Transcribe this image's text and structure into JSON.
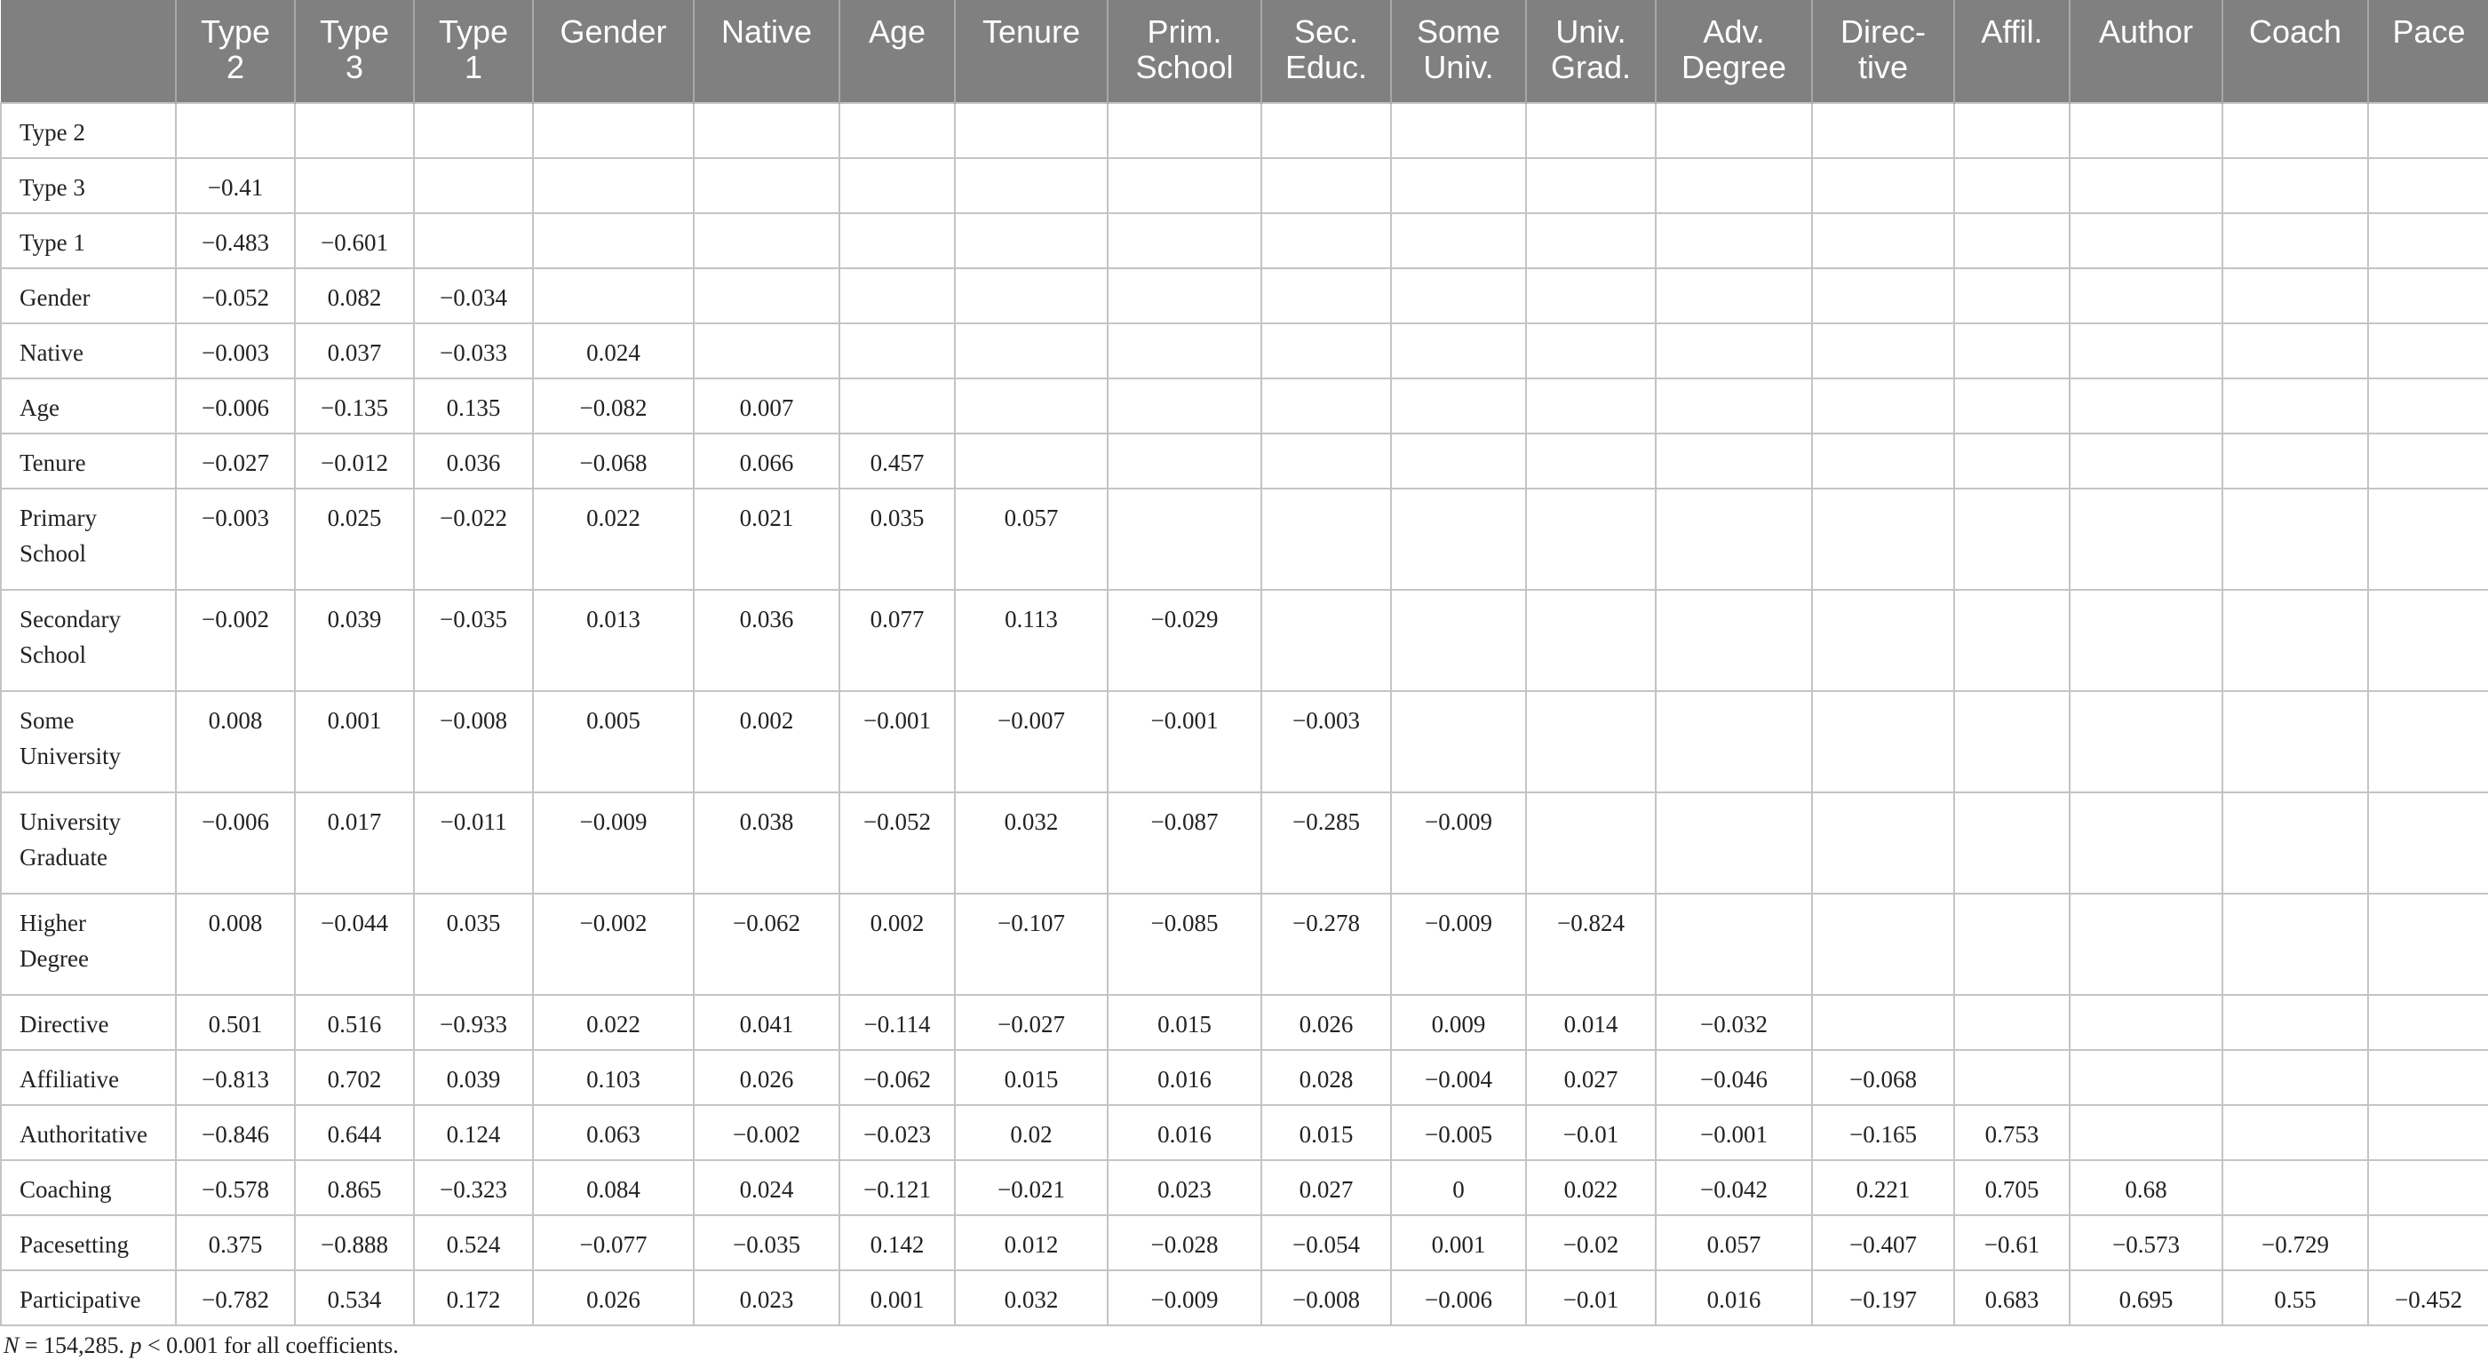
{
  "table": {
    "columns": [
      "",
      "Type\n2",
      "Type\n3",
      "Type\n1",
      "Gender",
      "Native",
      "Age",
      "Tenure",
      "Prim.\nSchool",
      "Sec.\nEduc.",
      "Some\nUniv.",
      "Univ.\nGrad.",
      "Adv.\nDegree",
      "Direc-\ntive",
      "Affil.",
      "Author",
      "Coach",
      "Pace"
    ],
    "rows": [
      {
        "label": "Type 2",
        "cells": []
      },
      {
        "label": "Type 3",
        "cells": [
          "−0.41"
        ]
      },
      {
        "label": "Type 1",
        "cells": [
          "−0.483",
          "−0.601"
        ]
      },
      {
        "label": "Gender",
        "cells": [
          "−0.052",
          "0.082",
          "−0.034"
        ]
      },
      {
        "label": "Native",
        "cells": [
          "−0.003",
          "0.037",
          "−0.033",
          "0.024"
        ]
      },
      {
        "label": "Age",
        "cells": [
          "−0.006",
          "−0.135",
          "0.135",
          "−0.082",
          "0.007"
        ]
      },
      {
        "label": "Tenure",
        "cells": [
          "−0.027",
          "−0.012",
          "0.036",
          "−0.068",
          "0.066",
          "0.457"
        ]
      },
      {
        "label": "Primary\nSchool",
        "cells": [
          "−0.003",
          "0.025",
          "−0.022",
          "0.022",
          "0.021",
          "0.035",
          "0.057"
        ]
      },
      {
        "label": "Secondary\nSchool",
        "cells": [
          "−0.002",
          "0.039",
          "−0.035",
          "0.013",
          "0.036",
          "0.077",
          "0.113",
          "−0.029"
        ]
      },
      {
        "label": "Some\nUniversity",
        "cells": [
          "0.008",
          "0.001",
          "−0.008",
          "0.005",
          "0.002",
          "−0.001",
          "−0.007",
          "−0.001",
          "−0.003"
        ]
      },
      {
        "label": "University\nGraduate",
        "cells": [
          "−0.006",
          "0.017",
          "−0.011",
          "−0.009",
          "0.038",
          "−0.052",
          "0.032",
          "−0.087",
          "−0.285",
          "−0.009"
        ]
      },
      {
        "label": "Higher\nDegree",
        "cells": [
          "0.008",
          "−0.044",
          "0.035",
          "−0.002",
          "−0.062",
          "0.002",
          "−0.107",
          "−0.085",
          "−0.278",
          "−0.009",
          "−0.824"
        ]
      },
      {
        "label": "Directive",
        "cells": [
          "0.501",
          "0.516",
          "−0.933",
          "0.022",
          "0.041",
          "−0.114",
          "−0.027",
          "0.015",
          "0.026",
          "0.009",
          "0.014",
          "−0.032"
        ]
      },
      {
        "label": "Affiliative",
        "cells": [
          "−0.813",
          "0.702",
          "0.039",
          "0.103",
          "0.026",
          "−0.062",
          "0.015",
          "0.016",
          "0.028",
          "−0.004",
          "0.027",
          "−0.046",
          "−0.068"
        ]
      },
      {
        "label": "Authoritative",
        "cells": [
          "−0.846",
          "0.644",
          "0.124",
          "0.063",
          "−0.002",
          "−0.023",
          "0.02",
          "0.016",
          "0.015",
          "−0.005",
          "−0.01",
          "−0.001",
          "−0.165",
          "0.753"
        ]
      },
      {
        "label": "Coaching",
        "cells": [
          "−0.578",
          "0.865",
          "−0.323",
          "0.084",
          "0.024",
          "−0.121",
          "−0.021",
          "0.023",
          "0.027",
          "0",
          "0.022",
          "−0.042",
          "0.221",
          "0.705",
          "0.68"
        ]
      },
      {
        "label": "Pacesetting",
        "cells": [
          "0.375",
          "−0.888",
          "0.524",
          "−0.077",
          "−0.035",
          "0.142",
          "0.012",
          "−0.028",
          "−0.054",
          "0.001",
          "−0.02",
          "0.057",
          "−0.407",
          "−0.61",
          "−0.573",
          "−0.729"
        ]
      },
      {
        "label": "Participative",
        "cells": [
          "−0.782",
          "0.534",
          "0.172",
          "0.026",
          "0.023",
          "0.001",
          "0.032",
          "−0.009",
          "−0.008",
          "−0.006",
          "−0.01",
          "0.016",
          "−0.197",
          "0.683",
          "0.695",
          "0.55",
          "−0.452"
        ]
      }
    ]
  },
  "note": {
    "n_label": "N",
    "n_value": " = 154,285. ",
    "p_label": "p",
    "p_value": " < 0.001 for all coefficients."
  }
}
